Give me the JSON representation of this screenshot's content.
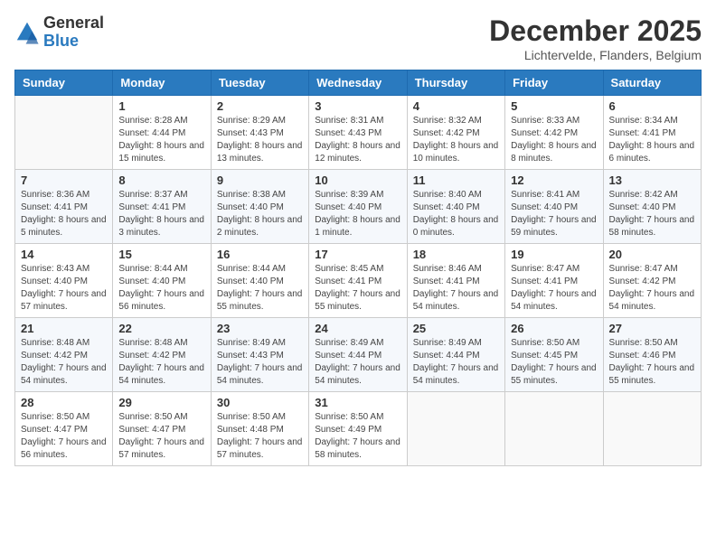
{
  "logo": {
    "general": "General",
    "blue": "Blue"
  },
  "header": {
    "month": "December 2025",
    "location": "Lichtervelde, Flanders, Belgium"
  },
  "days_of_week": [
    "Sunday",
    "Monday",
    "Tuesday",
    "Wednesday",
    "Thursday",
    "Friday",
    "Saturday"
  ],
  "weeks": [
    [
      {
        "day": "",
        "sunrise": "",
        "sunset": "",
        "daylight": ""
      },
      {
        "day": "1",
        "sunrise": "Sunrise: 8:28 AM",
        "sunset": "Sunset: 4:44 PM",
        "daylight": "Daylight: 8 hours and 15 minutes."
      },
      {
        "day": "2",
        "sunrise": "Sunrise: 8:29 AM",
        "sunset": "Sunset: 4:43 PM",
        "daylight": "Daylight: 8 hours and 13 minutes."
      },
      {
        "day": "3",
        "sunrise": "Sunrise: 8:31 AM",
        "sunset": "Sunset: 4:43 PM",
        "daylight": "Daylight: 8 hours and 12 minutes."
      },
      {
        "day": "4",
        "sunrise": "Sunrise: 8:32 AM",
        "sunset": "Sunset: 4:42 PM",
        "daylight": "Daylight: 8 hours and 10 minutes."
      },
      {
        "day": "5",
        "sunrise": "Sunrise: 8:33 AM",
        "sunset": "Sunset: 4:42 PM",
        "daylight": "Daylight: 8 hours and 8 minutes."
      },
      {
        "day": "6",
        "sunrise": "Sunrise: 8:34 AM",
        "sunset": "Sunset: 4:41 PM",
        "daylight": "Daylight: 8 hours and 6 minutes."
      }
    ],
    [
      {
        "day": "7",
        "sunrise": "Sunrise: 8:36 AM",
        "sunset": "Sunset: 4:41 PM",
        "daylight": "Daylight: 8 hours and 5 minutes."
      },
      {
        "day": "8",
        "sunrise": "Sunrise: 8:37 AM",
        "sunset": "Sunset: 4:41 PM",
        "daylight": "Daylight: 8 hours and 3 minutes."
      },
      {
        "day": "9",
        "sunrise": "Sunrise: 8:38 AM",
        "sunset": "Sunset: 4:40 PM",
        "daylight": "Daylight: 8 hours and 2 minutes."
      },
      {
        "day": "10",
        "sunrise": "Sunrise: 8:39 AM",
        "sunset": "Sunset: 4:40 PM",
        "daylight": "Daylight: 8 hours and 1 minute."
      },
      {
        "day": "11",
        "sunrise": "Sunrise: 8:40 AM",
        "sunset": "Sunset: 4:40 PM",
        "daylight": "Daylight: 8 hours and 0 minutes."
      },
      {
        "day": "12",
        "sunrise": "Sunrise: 8:41 AM",
        "sunset": "Sunset: 4:40 PM",
        "daylight": "Daylight: 7 hours and 59 minutes."
      },
      {
        "day": "13",
        "sunrise": "Sunrise: 8:42 AM",
        "sunset": "Sunset: 4:40 PM",
        "daylight": "Daylight: 7 hours and 58 minutes."
      }
    ],
    [
      {
        "day": "14",
        "sunrise": "Sunrise: 8:43 AM",
        "sunset": "Sunset: 4:40 PM",
        "daylight": "Daylight: 7 hours and 57 minutes."
      },
      {
        "day": "15",
        "sunrise": "Sunrise: 8:44 AM",
        "sunset": "Sunset: 4:40 PM",
        "daylight": "Daylight: 7 hours and 56 minutes."
      },
      {
        "day": "16",
        "sunrise": "Sunrise: 8:44 AM",
        "sunset": "Sunset: 4:40 PM",
        "daylight": "Daylight: 7 hours and 55 minutes."
      },
      {
        "day": "17",
        "sunrise": "Sunrise: 8:45 AM",
        "sunset": "Sunset: 4:41 PM",
        "daylight": "Daylight: 7 hours and 55 minutes."
      },
      {
        "day": "18",
        "sunrise": "Sunrise: 8:46 AM",
        "sunset": "Sunset: 4:41 PM",
        "daylight": "Daylight: 7 hours and 54 minutes."
      },
      {
        "day": "19",
        "sunrise": "Sunrise: 8:47 AM",
        "sunset": "Sunset: 4:41 PM",
        "daylight": "Daylight: 7 hours and 54 minutes."
      },
      {
        "day": "20",
        "sunrise": "Sunrise: 8:47 AM",
        "sunset": "Sunset: 4:42 PM",
        "daylight": "Daylight: 7 hours and 54 minutes."
      }
    ],
    [
      {
        "day": "21",
        "sunrise": "Sunrise: 8:48 AM",
        "sunset": "Sunset: 4:42 PM",
        "daylight": "Daylight: 7 hours and 54 minutes."
      },
      {
        "day": "22",
        "sunrise": "Sunrise: 8:48 AM",
        "sunset": "Sunset: 4:42 PM",
        "daylight": "Daylight: 7 hours and 54 minutes."
      },
      {
        "day": "23",
        "sunrise": "Sunrise: 8:49 AM",
        "sunset": "Sunset: 4:43 PM",
        "daylight": "Daylight: 7 hours and 54 minutes."
      },
      {
        "day": "24",
        "sunrise": "Sunrise: 8:49 AM",
        "sunset": "Sunset: 4:44 PM",
        "daylight": "Daylight: 7 hours and 54 minutes."
      },
      {
        "day": "25",
        "sunrise": "Sunrise: 8:49 AM",
        "sunset": "Sunset: 4:44 PM",
        "daylight": "Daylight: 7 hours and 54 minutes."
      },
      {
        "day": "26",
        "sunrise": "Sunrise: 8:50 AM",
        "sunset": "Sunset: 4:45 PM",
        "daylight": "Daylight: 7 hours and 55 minutes."
      },
      {
        "day": "27",
        "sunrise": "Sunrise: 8:50 AM",
        "sunset": "Sunset: 4:46 PM",
        "daylight": "Daylight: 7 hours and 55 minutes."
      }
    ],
    [
      {
        "day": "28",
        "sunrise": "Sunrise: 8:50 AM",
        "sunset": "Sunset: 4:47 PM",
        "daylight": "Daylight: 7 hours and 56 minutes."
      },
      {
        "day": "29",
        "sunrise": "Sunrise: 8:50 AM",
        "sunset": "Sunset: 4:47 PM",
        "daylight": "Daylight: 7 hours and 57 minutes."
      },
      {
        "day": "30",
        "sunrise": "Sunrise: 8:50 AM",
        "sunset": "Sunset: 4:48 PM",
        "daylight": "Daylight: 7 hours and 57 minutes."
      },
      {
        "day": "31",
        "sunrise": "Sunrise: 8:50 AM",
        "sunset": "Sunset: 4:49 PM",
        "daylight": "Daylight: 7 hours and 58 minutes."
      },
      {
        "day": "",
        "sunrise": "",
        "sunset": "",
        "daylight": ""
      },
      {
        "day": "",
        "sunrise": "",
        "sunset": "",
        "daylight": ""
      },
      {
        "day": "",
        "sunrise": "",
        "sunset": "",
        "daylight": ""
      }
    ]
  ]
}
